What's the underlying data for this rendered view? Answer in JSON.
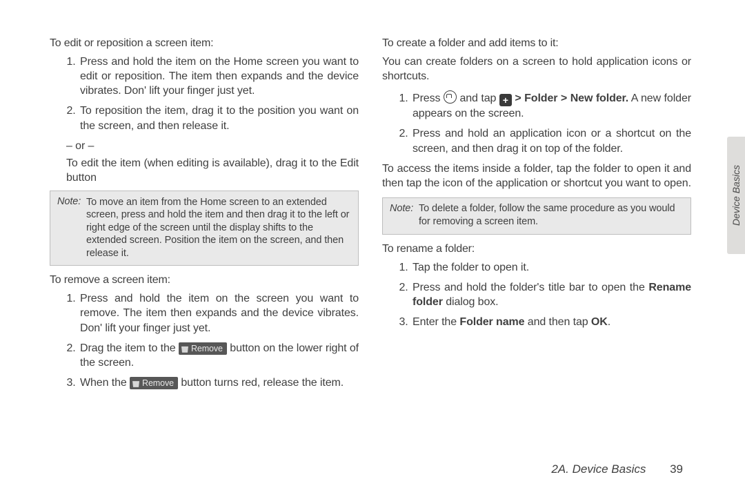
{
  "left": {
    "h1": "To edit or reposition a screen item:",
    "l1": "Press and hold the item on the Home screen you want to edit or reposition. The item then expands and the device vibrates. Don' lift your finger just yet.",
    "l2": "To reposition the item, drag it to the position you want on the screen, and then release it.",
    "or": "– or –",
    "edit": "To edit the item (when editing is available), drag it to the Edit button",
    "note_label": "Note:",
    "note_body": "To move an item from the Home screen to an extended screen, press and hold the item and then drag it to the left or right edge of the screen until the display shifts to the extended screen. Position the item on the screen, and then release it.",
    "h2": "To remove a screen item:",
    "r1": "Press and hold the item on the screen you want to remove. The item then expands and the device vibrates. Don' lift your finger just yet.",
    "r2a": "Drag the item to the ",
    "r2b": " button on the lower right of the screen.",
    "r3a": "When the ",
    "r3b": " button turns red, release the item.",
    "remove_label": "Remove"
  },
  "right": {
    "h1": "To create a folder and add items to it:",
    "p1": "You can create folders on a screen to hold application icons or shortcuts.",
    "c1a": "Press ",
    "c1b": " and tap ",
    "c1_bold": " > Folder > New folder.",
    "c1c": " A new folder appears on the screen.",
    "c2": "Press and hold an application icon or a shortcut on the screen, and then drag it on top of the folder.",
    "p2": "To access the items inside a folder, tap the folder to open it and then tap the icon of the application or shortcut you want to open.",
    "note_label": "Note:",
    "note_body": "To delete a folder, follow the same procedure as you would for removing a screen item.",
    "h2": "To rename a folder:",
    "n1": "Tap the folder to open it.",
    "n2a": "Press and hold the folder's title bar to open the ",
    "n2_bold": "Rename folder",
    "n2b": " dialog box.",
    "n3a": "Enter the ",
    "n3_bold1": "Folder name",
    "n3b": " and then tap ",
    "n3_bold2": "OK",
    "n3c": "."
  },
  "sidetab": "Device Basics",
  "footer_section": "2A. Device Basics",
  "footer_page": "39",
  "plus_glyph": "+"
}
